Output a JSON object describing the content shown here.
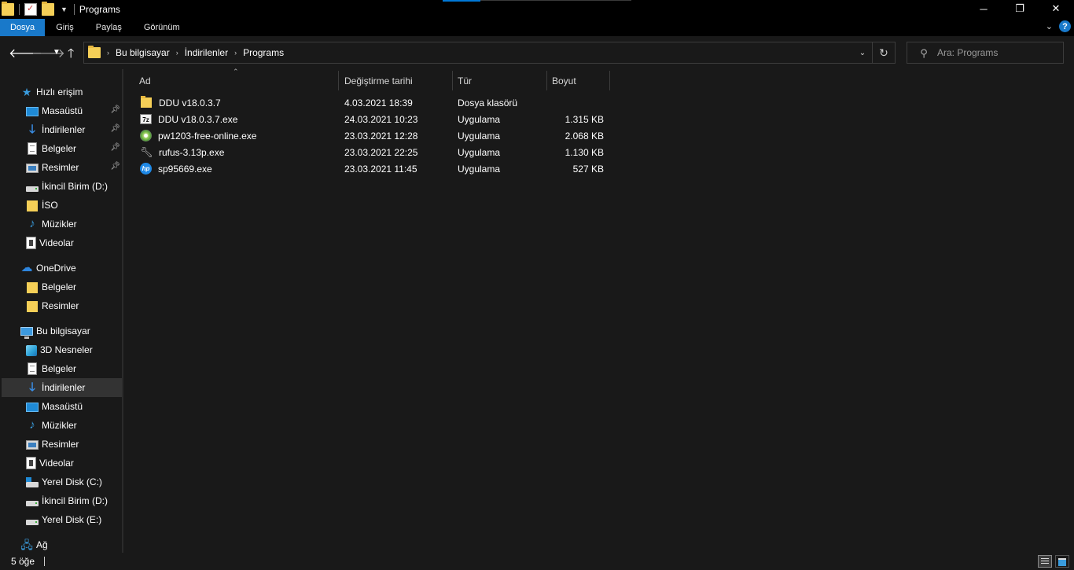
{
  "window": {
    "title": "Programs",
    "controls": {
      "minimize": "─",
      "maximize": "❐",
      "close": "✕"
    }
  },
  "ribbon": {
    "tabs": [
      "Dosya",
      "Giriş",
      "Paylaş",
      "Görünüm"
    ],
    "help": "?"
  },
  "address": {
    "crumbs": [
      "Bu bilgisayar",
      "İndirilenler",
      "Programs"
    ]
  },
  "search": {
    "placeholder": "Ara: Programs"
  },
  "sidebar": {
    "quick_access": "Hızlı erişim",
    "quick_items": [
      "Masaüstü",
      "İndirilenler",
      "Belgeler",
      "Resimler",
      "İkincil Birim (D:)",
      "İSO",
      "Müzikler",
      "Videolar"
    ],
    "onedrive": "OneDrive",
    "onedrive_items": [
      "Belgeler",
      "Resimler"
    ],
    "this_pc": "Bu bilgisayar",
    "pc_items": [
      "3D Nesneler",
      "Belgeler",
      "İndirilenler",
      "Masaüstü",
      "Müzikler",
      "Resimler",
      "Videolar",
      "Yerel Disk (C:)",
      "İkincil Birim (D:)",
      "Yerel Disk (E:)"
    ],
    "network": "Ağ"
  },
  "columns": {
    "name": "Ad",
    "date": "Değiştirme tarihi",
    "type": "Tür",
    "size": "Boyut"
  },
  "files": [
    {
      "name": "DDU v18.0.3.7",
      "date": "4.03.2021 18:39",
      "type": "Dosya klasörü",
      "size": "",
      "icon": "folder-icon"
    },
    {
      "name": "DDU v18.0.3.7.exe",
      "date": "24.03.2021 10:23",
      "type": "Uygulama",
      "size": "1.315 KB",
      "icon": "7zip-icon"
    },
    {
      "name": "pw1203-free-online.exe",
      "date": "23.03.2021 12:28",
      "type": "Uygulama",
      "size": "2.068 KB",
      "icon": "disk-icon"
    },
    {
      "name": "rufus-3.13p.exe",
      "date": "23.03.2021 22:25",
      "type": "Uygulama",
      "size": "1.130 KB",
      "icon": "rufus-icon"
    },
    {
      "name": "sp95669.exe",
      "date": "23.03.2021 11:45",
      "type": "Uygulama",
      "size": "527 KB",
      "icon": "hp-icon"
    }
  ],
  "status": {
    "count": "5 öğe"
  },
  "colors": {
    "accent": "#1979ca",
    "background": "#191919",
    "titlebar": "#000000",
    "folder": "#f5cf57"
  }
}
